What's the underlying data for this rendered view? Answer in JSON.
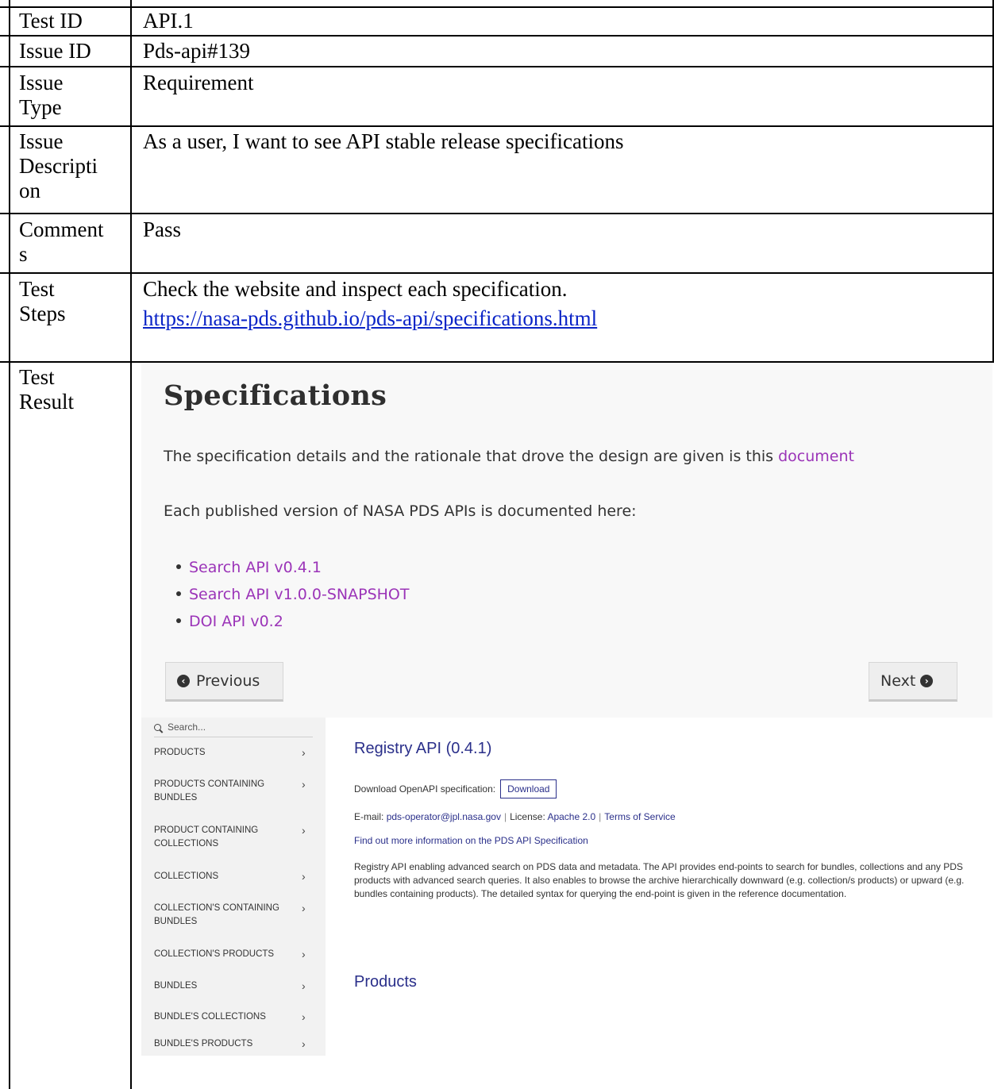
{
  "table": {
    "rows": [
      {
        "label": "Test ID",
        "value": "API.1"
      },
      {
        "label": "Issue ID",
        "value": "Pds-api#139"
      },
      {
        "label": "Issue\nType",
        "value": "Requirement"
      },
      {
        "label": "Issue\nDescripti\non",
        "value": "As a user, I want to see API stable release specifications"
      },
      {
        "label": "Comment\ns",
        "value": "Pass"
      },
      {
        "label": "Test\nSteps",
        "value": "Check the website and inspect each specification."
      },
      {
        "label": "Test\nResult",
        "value": ""
      }
    ],
    "steps_link": "https://nasa-pds.github.io/pds-api/specifications.html"
  },
  "spec_page": {
    "title": "Specifications",
    "intro_text": "The specification details and the rationale that drove the design are given is this",
    "intro_link": "document",
    "versions_text": "Each published version of NASA PDS APIs is documented here:",
    "versions": [
      "Search API v0.4.1",
      "Search API v1.0.0-SNAPSHOT",
      "DOI API v0.2"
    ],
    "prev_label": "Previous",
    "next_label": "Next",
    "link_color": "#9b34b8"
  },
  "registry_page": {
    "search_placeholder": "Search...",
    "sidebar": [
      "PRODUCTS",
      "PRODUCTS CONTAINING BUNDLES",
      "PRODUCT CONTAINING COLLECTIONS",
      "COLLECTIONS",
      "COLLECTION'S CONTAINING BUNDLES",
      "COLLECTION'S PRODUCTS",
      "BUNDLES",
      "BUNDLE'S COLLECTIONS",
      "BUNDLE'S PRODUCTS"
    ],
    "title": "Registry API (0.4.1)",
    "download_label": "Download OpenAPI specification:",
    "download_button": "Download",
    "email_label": "E-mail:",
    "email": "pds-operator@jpl.nasa.gov",
    "license_label": "License:",
    "license": "Apache 2.0",
    "terms": "Terms of Service",
    "find_out": "Find out more information on the PDS API Specification",
    "description": "Registry API enabling advanced search on PDS data and metadata. The API provides end-points to search for bundles, collections and any PDS products with advanced search queries. It also enables to browse the archive hierarchically downward (e.g. collection/s products) or upward (e.g. bundles containing products). The detailed syntax for querying the end-point is given in the reference documentation.",
    "section_title": "Products",
    "accent": "#2a2f8a"
  }
}
